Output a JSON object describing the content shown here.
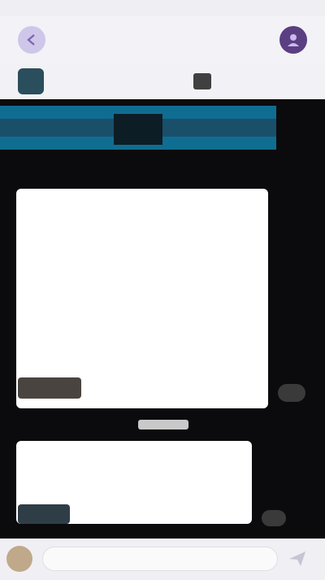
{
  "status_bar": {
    "time": ""
  },
  "top_bar": {
    "title": "",
    "left_icon": "back-icon",
    "right_icon": "profile-icon"
  },
  "chat_header": {
    "subtitle": "",
    "menu_icon": "menu-icon"
  },
  "messages": [
    {
      "lines": [
        "",
        "",
        "",
        "",
        "",
        "",
        "",
        "",
        "",
        ""
      ],
      "link_line": "",
      "tag_line": ""
    },
    {
      "lines": [
        "",
        "",
        "",
        ""
      ]
    }
  ],
  "input": {
    "placeholder": "",
    "value": ""
  },
  "colors": {
    "background": "#0b0b0d",
    "bar": "#f3f2f6",
    "bubble": "#ffffff",
    "accent": "#5a3f82",
    "link": "#3a8fd0",
    "media": "#0f6d92"
  }
}
